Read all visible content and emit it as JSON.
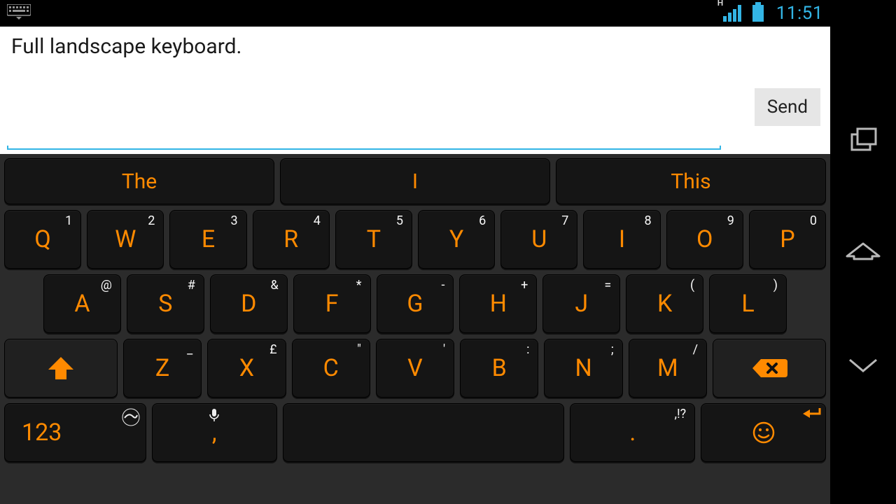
{
  "status": {
    "clock": "11:51",
    "network_indicator": "H"
  },
  "compose": {
    "text": "Full landscape keyboard.",
    "send_label": "Send"
  },
  "suggestions": [
    "The",
    "I",
    "This"
  ],
  "rows": {
    "r1": [
      {
        "k": "Q",
        "s": "1"
      },
      {
        "k": "W",
        "s": "2"
      },
      {
        "k": "E",
        "s": "3"
      },
      {
        "k": "R",
        "s": "4"
      },
      {
        "k": "T",
        "s": "5"
      },
      {
        "k": "Y",
        "s": "6"
      },
      {
        "k": "U",
        "s": "7"
      },
      {
        "k": "I",
        "s": "8"
      },
      {
        "k": "O",
        "s": "9"
      },
      {
        "k": "P",
        "s": "0"
      }
    ],
    "r2": [
      {
        "k": "A",
        "s": "@"
      },
      {
        "k": "S",
        "s": "#"
      },
      {
        "k": "D",
        "s": "&"
      },
      {
        "k": "F",
        "s": "*"
      },
      {
        "k": "G",
        "s": "-"
      },
      {
        "k": "H",
        "s": "+"
      },
      {
        "k": "J",
        "s": "="
      },
      {
        "k": "K",
        "s": "("
      },
      {
        "k": "L",
        "s": ")"
      }
    ],
    "r3": [
      {
        "k": "Z",
        "s": "_"
      },
      {
        "k": "X",
        "s": "£"
      },
      {
        "k": "C",
        "s": "\""
      },
      {
        "k": "V",
        "s": "'"
      },
      {
        "k": "B",
        "s": ":"
      },
      {
        "k": "N",
        "s": ";"
      },
      {
        "k": "M",
        "s": "/"
      }
    ],
    "r4": {
      "sym": "123",
      "comma": ",",
      "period": ".",
      "period_sub": ",!?"
    }
  }
}
